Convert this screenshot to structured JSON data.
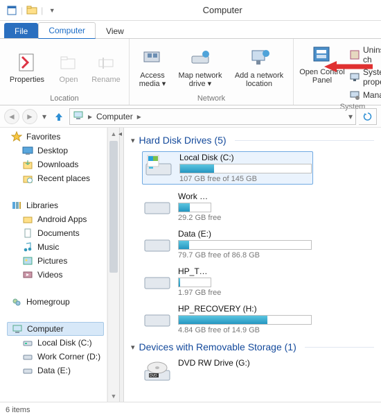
{
  "window": {
    "title": "Computer"
  },
  "tabs": {
    "file": "File",
    "computer": "Computer",
    "view": "View"
  },
  "ribbon": {
    "location": {
      "properties": "Properties",
      "open": "Open",
      "rename": "Rename",
      "label": "Location"
    },
    "network": {
      "access": "Access media",
      "map": "Map network drive",
      "add": "Add a network location",
      "label": "Network"
    },
    "system": {
      "openctrl": "Open Control Panel",
      "uninstall": "Uninstall or ch",
      "sysprop": "System proper",
      "manage": "Manage",
      "label": "System"
    }
  },
  "breadcrumb": {
    "root": "Computer"
  },
  "refresh_alt": "↻",
  "sidebar": {
    "favorites": {
      "label": "Favorites",
      "items": [
        "Desktop",
        "Downloads",
        "Recent places"
      ]
    },
    "libraries": {
      "label": "Libraries",
      "items": [
        "Android Apps",
        "Documents",
        "Music",
        "Pictures",
        "Videos"
      ]
    },
    "homegroup": {
      "label": "Homegroup"
    },
    "computer": {
      "label": "Computer",
      "items": [
        "Local Disk (C:)",
        "Work Corner (D:)",
        "Data (E:)"
      ]
    }
  },
  "groups": {
    "hdd": {
      "title": "Hard Disk Drives (5)"
    },
    "removable": {
      "title": "Devices with Removable Storage (1)"
    }
  },
  "drives": {
    "c": {
      "name": "Local Disk (C:)",
      "free": "107 GB free of 145 GB",
      "fill_pct": 26
    },
    "work": {
      "name": "Work Corn",
      "free": "29.2 GB free"
    },
    "e": {
      "name": "Data (E:)",
      "free": "79.7 GB free of 86.8 GB",
      "fill_pct": 8
    },
    "hpt": {
      "name": "HP_TOOLS",
      "free": "1.97 GB free"
    },
    "hpr": {
      "name": "HP_RECOVERY (H:)",
      "free": "4.84 GB free of 14.9 GB",
      "fill_pct": 67
    },
    "dvd": {
      "name": "DVD RW Drive (G:)"
    }
  },
  "status": {
    "text": "6 items"
  }
}
